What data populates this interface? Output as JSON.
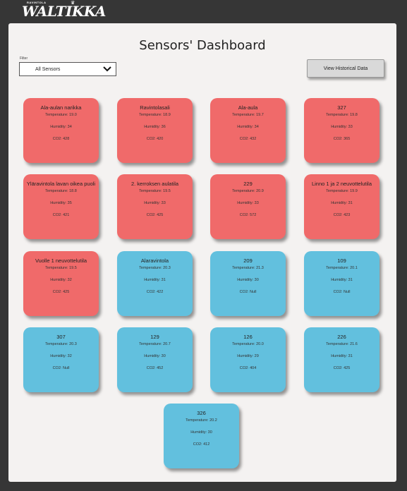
{
  "logo": {
    "small_text": "RAVINTOLA",
    "brand": "WALTIKKA"
  },
  "page": {
    "title": "Sensors' Dashboard",
    "filter_label": "Filter",
    "filter_value": "All Sensors",
    "historical_button": "View Historical Data"
  },
  "labels": {
    "temperature": "Temperature",
    "humidity": "Humidity",
    "co2": "CO2"
  },
  "colors": {
    "alert": "#f06a6a",
    "normal": "#62c0de",
    "background": "#363636",
    "panel": "#f4f2f1"
  },
  "sensors": [
    {
      "name": "Ala-aulan narikka",
      "temperature": "Temperature: 19.0",
      "humidity": "Humidity: 34",
      "co2": "CO2: 428",
      "status": "alert"
    },
    {
      "name": "Ravintolasali",
      "temperature": "Temperature: 18.9",
      "humidity": "Humidity: 36",
      "co2": "CO2: 420",
      "status": "alert"
    },
    {
      "name": "Ala-aula",
      "temperature": "Temperature: 19.7",
      "humidity": "Humidity: 34",
      "co2": "CO2: 432",
      "status": "alert"
    },
    {
      "name": "327",
      "temperature": "Temperature: 19.8",
      "humidity": "Humidity: 33",
      "co2": "CO2: 365",
      "status": "alert"
    },
    {
      "name": "Yläravintola lavan oikea puoli",
      "temperature": "Temperature: 18.8",
      "humidity": "Humidity: 35",
      "co2": "CO2: 421",
      "status": "alert"
    },
    {
      "name": "2. kerroksen aulatila",
      "temperature": "Temperature: 19.5",
      "humidity": "Humidity: 33",
      "co2": "CO2: 425",
      "status": "alert"
    },
    {
      "name": "229",
      "temperature": "Temperature: 20.9",
      "humidity": "Humidity: 33",
      "co2": "CO2: 572",
      "status": "alert"
    },
    {
      "name": "Linno 1 ja 2 neuvottelutila",
      "temperature": "Temperature: 19.9",
      "humidity": "Humidity: 31",
      "co2": "CO2: 423",
      "status": "alert"
    },
    {
      "name": "Vuolle 1 neuvottelutila",
      "temperature": "Temperature: 19.5",
      "humidity": "Humidity: 32",
      "co2": "CO2: 425",
      "status": "alert"
    },
    {
      "name": "Alaravintola",
      "temperature": "Temperature: 20.3",
      "humidity": "Humidity: 31",
      "co2": "CO2: 422",
      "status": "normal"
    },
    {
      "name": "209",
      "temperature": "Temperature: 21.3",
      "humidity": "Humidity: 30",
      "co2": "CO2: Null",
      "status": "normal"
    },
    {
      "name": "109",
      "temperature": "Temperature: 20.1",
      "humidity": "Humidity: 31",
      "co2": "CO2: Null",
      "status": "normal"
    },
    {
      "name": "307",
      "temperature": "Temperature: 20.3",
      "humidity": "Humidity: 32",
      "co2": "CO2: Null",
      "status": "normal"
    },
    {
      "name": "129",
      "temperature": "Temperature: 20.7",
      "humidity": "Humidity: 30",
      "co2": "CO2: 452",
      "status": "normal"
    },
    {
      "name": "126",
      "temperature": "Temperature: 20.0",
      "humidity": "Humidity: 29",
      "co2": "CO2: 404",
      "status": "normal"
    },
    {
      "name": "226",
      "temperature": "Temperature: 21.6",
      "humidity": "Humidity: 31",
      "co2": "CO2: 425",
      "status": "normal"
    },
    {
      "name": "326",
      "temperature": "Temperature: 20.2",
      "humidity": "Humidity: 30",
      "co2": "CO2: 412",
      "status": "normal"
    }
  ]
}
